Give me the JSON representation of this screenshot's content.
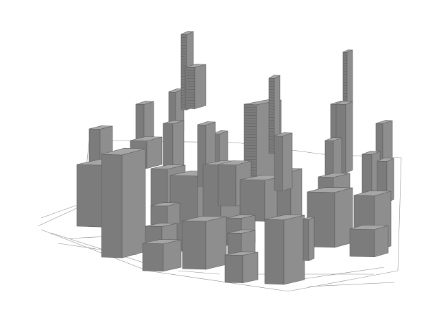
{
  "scene": {
    "subject": "3d-city-block-render",
    "background": "#ffffff",
    "colors": {
      "top": "#a6a6a6",
      "left": "#7c7c7c",
      "right": "#8e8e8e",
      "edge": "#5e5e5e",
      "wire": "#8a8a8a",
      "window": "#5a5a5a"
    }
  }
}
